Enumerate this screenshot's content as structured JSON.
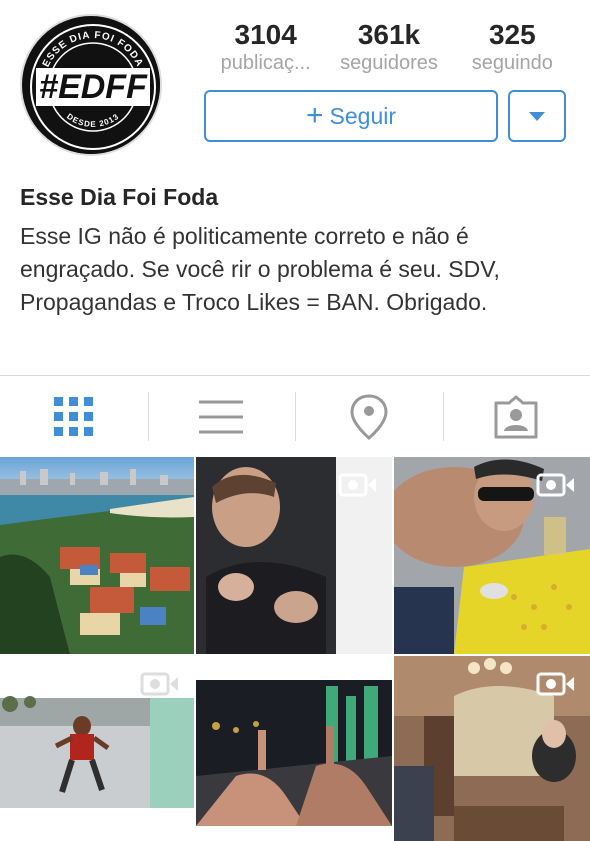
{
  "profile": {
    "logo_text": "#EDFF",
    "logo_top": "ESSE DIA FOI FODA",
    "logo_bottom": "DESDE 2013",
    "stats": [
      {
        "value": "3104",
        "label": "publicaç..."
      },
      {
        "value": "361k",
        "label": "seguidores"
      },
      {
        "value": "325",
        "label": "seguindo"
      }
    ],
    "follow_label": "Seguir",
    "name": "Esse Dia Foi Foda",
    "bio": "Esse IG não é politicamente correto e não é engraçado. Se você rir o problema é seu. SDV, Propagandas e Troco Likes = BAN. Obrigado."
  },
  "tabs": [
    {
      "icon": "grid-icon",
      "active": true
    },
    {
      "icon": "list-icon",
      "active": false
    },
    {
      "icon": "location-pin-icon",
      "active": false
    },
    {
      "icon": "tagged-photos-icon",
      "active": false
    }
  ],
  "colors": {
    "accent": "#3f8ed7",
    "inactive_icon": "#999999"
  },
  "posts": [
    {
      "kind": "photo",
      "subject": "coastal city view"
    },
    {
      "kind": "video",
      "subject": "child"
    },
    {
      "kind": "video",
      "subject": "man at table"
    },
    {
      "kind": "video",
      "subject": "person dancing"
    },
    {
      "kind": "photo",
      "subject": "hands at night street"
    },
    {
      "kind": "video",
      "subject": "party room"
    }
  ]
}
